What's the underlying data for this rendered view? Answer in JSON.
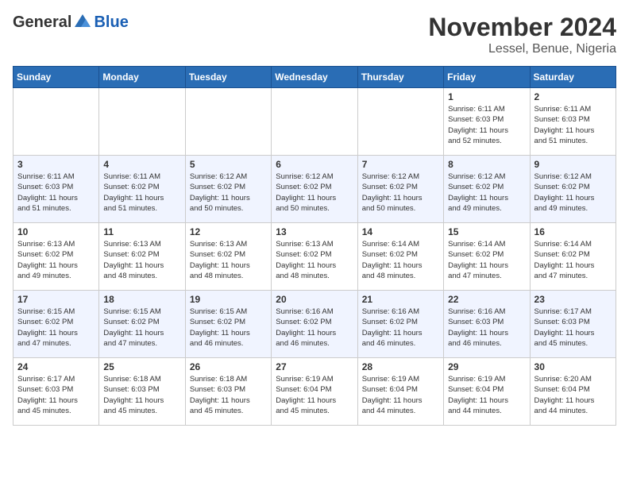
{
  "header": {
    "logo": {
      "general": "General",
      "blue": "Blue"
    },
    "title": "November 2024",
    "location": "Lessel, Benue, Nigeria"
  },
  "weekdays": [
    "Sunday",
    "Monday",
    "Tuesday",
    "Wednesday",
    "Thursday",
    "Friday",
    "Saturday"
  ],
  "weeks": [
    [
      {
        "day": "",
        "info": ""
      },
      {
        "day": "",
        "info": ""
      },
      {
        "day": "",
        "info": ""
      },
      {
        "day": "",
        "info": ""
      },
      {
        "day": "",
        "info": ""
      },
      {
        "day": "1",
        "info": "Sunrise: 6:11 AM\nSunset: 6:03 PM\nDaylight: 11 hours\nand 52 minutes."
      },
      {
        "day": "2",
        "info": "Sunrise: 6:11 AM\nSunset: 6:03 PM\nDaylight: 11 hours\nand 51 minutes."
      }
    ],
    [
      {
        "day": "3",
        "info": "Sunrise: 6:11 AM\nSunset: 6:03 PM\nDaylight: 11 hours\nand 51 minutes."
      },
      {
        "day": "4",
        "info": "Sunrise: 6:11 AM\nSunset: 6:02 PM\nDaylight: 11 hours\nand 51 minutes."
      },
      {
        "day": "5",
        "info": "Sunrise: 6:12 AM\nSunset: 6:02 PM\nDaylight: 11 hours\nand 50 minutes."
      },
      {
        "day": "6",
        "info": "Sunrise: 6:12 AM\nSunset: 6:02 PM\nDaylight: 11 hours\nand 50 minutes."
      },
      {
        "day": "7",
        "info": "Sunrise: 6:12 AM\nSunset: 6:02 PM\nDaylight: 11 hours\nand 50 minutes."
      },
      {
        "day": "8",
        "info": "Sunrise: 6:12 AM\nSunset: 6:02 PM\nDaylight: 11 hours\nand 49 minutes."
      },
      {
        "day": "9",
        "info": "Sunrise: 6:12 AM\nSunset: 6:02 PM\nDaylight: 11 hours\nand 49 minutes."
      }
    ],
    [
      {
        "day": "10",
        "info": "Sunrise: 6:13 AM\nSunset: 6:02 PM\nDaylight: 11 hours\nand 49 minutes."
      },
      {
        "day": "11",
        "info": "Sunrise: 6:13 AM\nSunset: 6:02 PM\nDaylight: 11 hours\nand 48 minutes."
      },
      {
        "day": "12",
        "info": "Sunrise: 6:13 AM\nSunset: 6:02 PM\nDaylight: 11 hours\nand 48 minutes."
      },
      {
        "day": "13",
        "info": "Sunrise: 6:13 AM\nSunset: 6:02 PM\nDaylight: 11 hours\nand 48 minutes."
      },
      {
        "day": "14",
        "info": "Sunrise: 6:14 AM\nSunset: 6:02 PM\nDaylight: 11 hours\nand 48 minutes."
      },
      {
        "day": "15",
        "info": "Sunrise: 6:14 AM\nSunset: 6:02 PM\nDaylight: 11 hours\nand 47 minutes."
      },
      {
        "day": "16",
        "info": "Sunrise: 6:14 AM\nSunset: 6:02 PM\nDaylight: 11 hours\nand 47 minutes."
      }
    ],
    [
      {
        "day": "17",
        "info": "Sunrise: 6:15 AM\nSunset: 6:02 PM\nDaylight: 11 hours\nand 47 minutes."
      },
      {
        "day": "18",
        "info": "Sunrise: 6:15 AM\nSunset: 6:02 PM\nDaylight: 11 hours\nand 47 minutes."
      },
      {
        "day": "19",
        "info": "Sunrise: 6:15 AM\nSunset: 6:02 PM\nDaylight: 11 hours\nand 46 minutes."
      },
      {
        "day": "20",
        "info": "Sunrise: 6:16 AM\nSunset: 6:02 PM\nDaylight: 11 hours\nand 46 minutes."
      },
      {
        "day": "21",
        "info": "Sunrise: 6:16 AM\nSunset: 6:02 PM\nDaylight: 11 hours\nand 46 minutes."
      },
      {
        "day": "22",
        "info": "Sunrise: 6:16 AM\nSunset: 6:03 PM\nDaylight: 11 hours\nand 46 minutes."
      },
      {
        "day": "23",
        "info": "Sunrise: 6:17 AM\nSunset: 6:03 PM\nDaylight: 11 hours\nand 45 minutes."
      }
    ],
    [
      {
        "day": "24",
        "info": "Sunrise: 6:17 AM\nSunset: 6:03 PM\nDaylight: 11 hours\nand 45 minutes."
      },
      {
        "day": "25",
        "info": "Sunrise: 6:18 AM\nSunset: 6:03 PM\nDaylight: 11 hours\nand 45 minutes."
      },
      {
        "day": "26",
        "info": "Sunrise: 6:18 AM\nSunset: 6:03 PM\nDaylight: 11 hours\nand 45 minutes."
      },
      {
        "day": "27",
        "info": "Sunrise: 6:19 AM\nSunset: 6:04 PM\nDaylight: 11 hours\nand 45 minutes."
      },
      {
        "day": "28",
        "info": "Sunrise: 6:19 AM\nSunset: 6:04 PM\nDaylight: 11 hours\nand 44 minutes."
      },
      {
        "day": "29",
        "info": "Sunrise: 6:19 AM\nSunset: 6:04 PM\nDaylight: 11 hours\nand 44 minutes."
      },
      {
        "day": "30",
        "info": "Sunrise: 6:20 AM\nSunset: 6:04 PM\nDaylight: 11 hours\nand 44 minutes."
      }
    ]
  ]
}
